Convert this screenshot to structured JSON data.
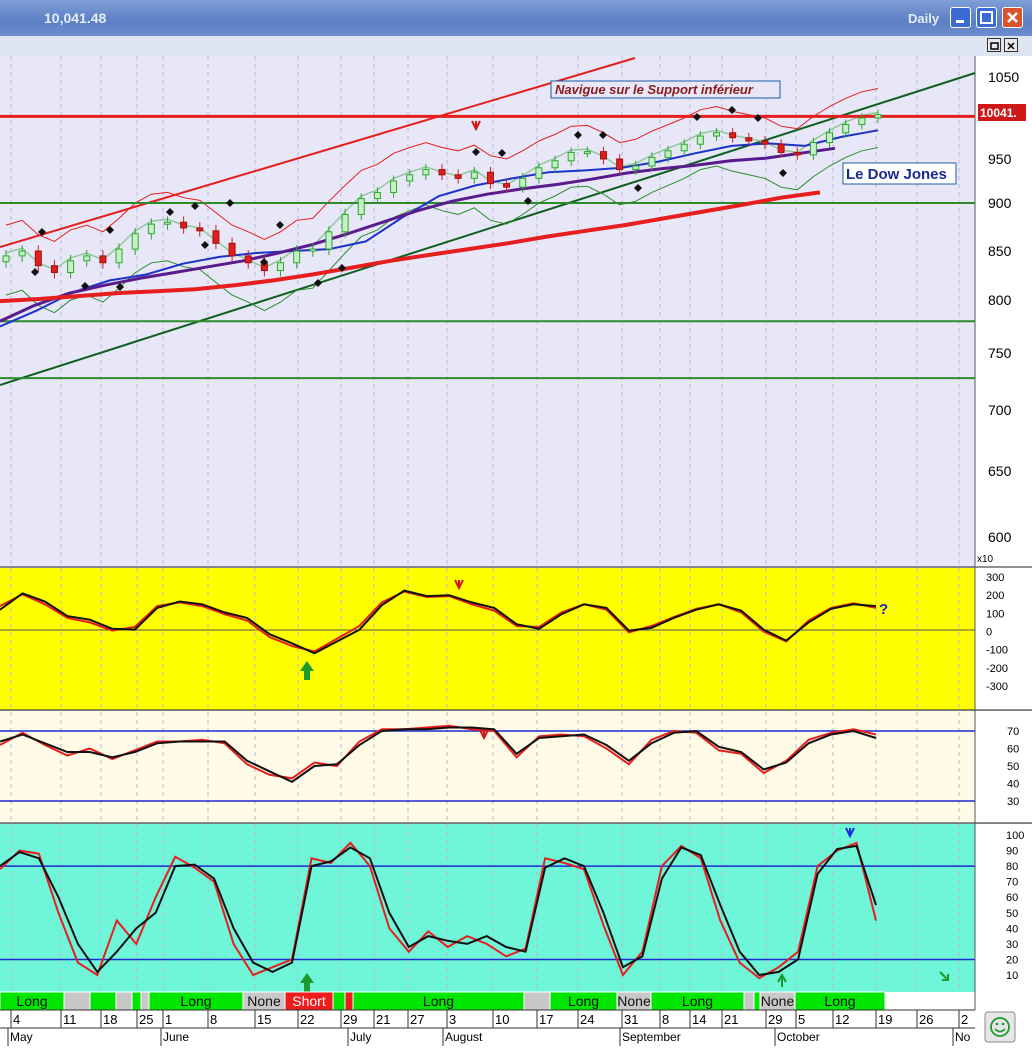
{
  "window": {
    "title_value": "10,041.48",
    "interval": "Daily",
    "colors": {
      "titlebar": "#6b8ed0",
      "close": "#d9542e"
    }
  },
  "annotations": {
    "support_note": "Navigue sur le Support inférieur",
    "index_name": "Le Dow Jones",
    "last_price_tag": "10041.",
    "scale_multiplier": "x10",
    "question_mark": "?"
  },
  "chart_data": [
    {
      "type": "candlestick",
      "panel": "price",
      "title": "",
      "y_ticks": [
        1050,
        950,
        900,
        850,
        800,
        750,
        700,
        650,
        600
      ],
      "y_multiplier_label": "x10",
      "ylim": [
        580,
        1065
      ],
      "series": [
        {
          "name": "",
          "color": "#1c32c8",
          "values": [
            775,
            790,
            808,
            820,
            826,
            837,
            844,
            848,
            850,
            852,
            860,
            885,
            908,
            920,
            928,
            935,
            937,
            940,
            947,
            957,
            966,
            969,
            966,
            977,
            985
          ]
        },
        {
          "name": "",
          "color": "#5a1c8c",
          "values": [
            780,
            795,
            807,
            815,
            822,
            828,
            834,
            840,
            848,
            857,
            868,
            880,
            892,
            902,
            910,
            916,
            921,
            927,
            934,
            939,
            943,
            948,
            951,
            957,
            963
          ]
        },
        {
          "name": "",
          "color": "#e61e1e",
          "values": [
            799,
            801,
            804,
            807,
            809,
            811,
            815,
            820,
            826,
            833,
            840,
            846,
            852,
            858,
            865,
            871,
            877,
            884,
            891,
            898,
            906,
            912
          ]
        }
      ],
      "close": [
        845,
        850,
        835,
        828,
        840,
        845,
        838,
        852,
        868,
        878,
        880,
        874,
        871,
        858,
        845,
        838,
        830,
        838,
        850,
        852,
        870,
        888,
        905,
        912,
        925,
        932,
        938,
        932,
        928,
        935,
        922,
        918,
        928,
        940,
        948,
        958,
        959,
        950,
        938,
        942,
        952,
        960,
        968,
        978,
        982,
        976,
        972,
        968,
        958,
        955,
        970,
        982,
        992,
        1000,
        1004
      ],
      "horizontal_lines": [
        {
          "value": 1002,
          "color": "#e61e1e"
        },
        {
          "value": 900,
          "color": "#2c8c2c"
        },
        {
          "value": 780,
          "color": "#2c8c2c"
        },
        {
          "value": 728,
          "color": "#2c8c2c"
        }
      ]
    },
    {
      "type": "line",
      "panel": "oscillator-1",
      "y_ticks": [
        300,
        200,
        100,
        0,
        -100,
        -200,
        -300
      ],
      "ylim": [
        -420,
        380
      ],
      "series": [
        {
          "name": "",
          "color": "#111111",
          "values": [
            120,
            210,
            165,
            85,
            65,
            15,
            10,
            130,
            165,
            150,
            105,
            75,
            -15,
            -65,
            -120,
            -55,
            10,
            145,
            225,
            195,
            200,
            160,
            130,
            40,
            15,
            95,
            150,
            130,
            5,
            20,
            75,
            120,
            150,
            115,
            10,
            -50,
            50,
            125,
            150,
            140
          ]
        },
        {
          "name": "",
          "color": "#e61e1e",
          "values": [
            140,
            205,
            150,
            75,
            50,
            5,
            25,
            140,
            160,
            140,
            95,
            60,
            -30,
            -80,
            -110,
            -40,
            30,
            160,
            220,
            190,
            195,
            150,
            115,
            30,
            25,
            105,
            150,
            120,
            -5,
            30,
            80,
            125,
            150,
            105,
            0,
            -55,
            60,
            130,
            155,
            130
          ]
        }
      ]
    },
    {
      "type": "line",
      "panel": "oscillator-2",
      "y_ticks": [
        70,
        60,
        50,
        40,
        30
      ],
      "reference_lines": [
        70,
        30
      ],
      "ylim": [
        22,
        78
      ],
      "series": [
        {
          "name": "",
          "color": "#111111",
          "values": [
            64,
            68,
            63,
            58,
            58,
            55,
            58,
            63,
            64,
            64,
            64,
            53,
            47,
            41,
            50,
            51,
            62,
            70,
            71,
            71,
            72,
            72,
            71,
            57,
            66,
            67,
            68,
            62,
            53,
            63,
            69,
            70,
            61,
            58,
            48,
            52,
            63,
            68,
            70,
            66
          ]
        },
        {
          "name": "",
          "color": "#e61e1e",
          "values": [
            62,
            69,
            62,
            56,
            60,
            54,
            59,
            64,
            64,
            65,
            63,
            51,
            45,
            43,
            52,
            50,
            64,
            71,
            71,
            72,
            73,
            71,
            70,
            55,
            67,
            68,
            67,
            60,
            51,
            65,
            70,
            69,
            59,
            57,
            46,
            53,
            65,
            69,
            71,
            68
          ]
        }
      ]
    },
    {
      "type": "line",
      "panel": "stochastic",
      "y_ticks": [
        100,
        90,
        80,
        70,
        60,
        50,
        40,
        30,
        20,
        10
      ],
      "reference_lines": [
        80,
        20
      ],
      "ylim": [
        0,
        105
      ],
      "series": [
        {
          "name": "",
          "color": "#111111",
          "values": [
            80,
            89,
            85,
            60,
            30,
            12,
            25,
            40,
            50,
            80,
            81,
            72,
            40,
            18,
            12,
            18,
            80,
            83,
            92,
            85,
            50,
            28,
            35,
            32,
            30,
            35,
            28,
            25,
            79,
            85,
            80,
            50,
            15,
            22,
            72,
            92,
            87,
            55,
            25,
            10,
            12,
            20,
            75,
            91,
            93,
            55
          ]
        },
        {
          "name": "",
          "color": "#e61e1e",
          "values": [
            78,
            90,
            88,
            50,
            18,
            10,
            45,
            30,
            60,
            86,
            79,
            70,
            30,
            10,
            15,
            20,
            85,
            82,
            95,
            80,
            40,
            25,
            38,
            28,
            35,
            30,
            22,
            27,
            85,
            82,
            78,
            42,
            10,
            25,
            80,
            93,
            85,
            45,
            18,
            8,
            15,
            25,
            80,
            90,
            95,
            45
          ]
        }
      ]
    },
    {
      "type": "table",
      "panel": "signals",
      "segments": [
        {
          "label": "Long",
          "color": "#00e600"
        },
        {
          "label": "",
          "color": "#c8c8c8"
        },
        {
          "label": "",
          "color": "#00e600"
        },
        {
          "label": "",
          "color": "#c8c8c8"
        },
        {
          "label": "",
          "color": "#00e600"
        },
        {
          "label": "",
          "color": "#c8c8c8"
        },
        {
          "label": "Long",
          "color": "#00e600"
        },
        {
          "label": "None",
          "color": "#c8c8c8"
        },
        {
          "label": "Short",
          "color": "#ee1c1c"
        },
        {
          "label": "",
          "color": "#00e600"
        },
        {
          "label": "",
          "color": "#ee1c1c"
        },
        {
          "label": "Long",
          "color": "#00e600"
        },
        {
          "label": "",
          "color": "#c8c8c8"
        },
        {
          "label": "Long",
          "color": "#00e600"
        },
        {
          "label": "None",
          "color": "#c8c8c8"
        },
        {
          "label": "Long",
          "color": "#00e600"
        },
        {
          "label": "",
          "color": "#c8c8c8"
        },
        {
          "label": "",
          "color": "#00e600"
        },
        {
          "label": "None",
          "color": "#c8c8c8"
        },
        {
          "label": "Long",
          "color": "#00e600"
        }
      ]
    }
  ],
  "x_axis": {
    "days": [
      "4",
      "11",
      "18",
      "25",
      "1",
      "8",
      "15",
      "22",
      "29",
      "21",
      "27",
      "3",
      "10",
      "17",
      "24",
      "31",
      "8",
      "14",
      "21",
      "29",
      "5",
      "12",
      "19",
      "26",
      "2"
    ],
    "months": [
      "May",
      "June",
      "July",
      "August",
      "September",
      "October",
      "No"
    ]
  }
}
